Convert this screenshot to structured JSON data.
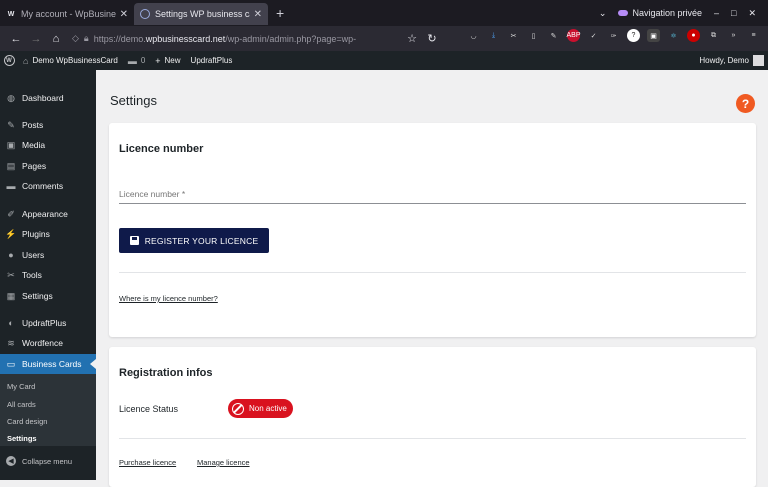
{
  "browser": {
    "tabs": [
      {
        "label": "My account - WpBusinessCard",
        "favicon": "W",
        "active": false
      },
      {
        "label": "Settings WP business card",
        "favicon": "",
        "active": true
      }
    ],
    "new_tab": "+",
    "private_label": "Navigation privée",
    "url_prefix": "https://demo.",
    "url_host": "wpbusinesscard.net",
    "url_path": "/wp-admin/admin.php?page=wp-"
  },
  "adminbar": {
    "site": "Demo WpBusinessCard",
    "comments_count": "0",
    "new_label": "New",
    "plugin_label": "UpdraftPlus",
    "howdy": "Howdy, Demo"
  },
  "sidebar": {
    "items": [
      {
        "label": "Dashboard",
        "icon": "dashboard-icon",
        "glyph": "◍"
      },
      {
        "label": "Posts",
        "icon": "pin-icon",
        "glyph": "✎"
      },
      {
        "label": "Media",
        "icon": "media-icon",
        "glyph": "▣"
      },
      {
        "label": "Pages",
        "icon": "pages-icon",
        "glyph": "▤"
      },
      {
        "label": "Comments",
        "icon": "comments-icon",
        "glyph": "▬"
      },
      {
        "label": "Appearance",
        "icon": "brush-icon",
        "glyph": "✐"
      },
      {
        "label": "Plugins",
        "icon": "plug-icon",
        "glyph": "⚡"
      },
      {
        "label": "Users",
        "icon": "user-icon",
        "glyph": "●"
      },
      {
        "label": "Tools",
        "icon": "wrench-icon",
        "glyph": "✂"
      },
      {
        "label": "Settings",
        "icon": "settings-icon",
        "glyph": "▦"
      },
      {
        "label": "UpdraftPlus",
        "icon": "updraft-icon",
        "glyph": "◐"
      },
      {
        "label": "Wordfence",
        "icon": "wordfence-icon",
        "glyph": "≋"
      },
      {
        "label": "Business Cards",
        "icon": "business-card-icon",
        "glyph": "▭"
      }
    ],
    "submenu": [
      "My Card",
      "All cards",
      "Card design",
      "Settings"
    ],
    "collapse": "Collapse menu"
  },
  "main": {
    "title": "Settings",
    "help": "?",
    "licence": {
      "title": "Licence number",
      "field_label": "Licence number *",
      "button": "REGISTER YOUR LICENCE",
      "help_link": "Where is my licence number?"
    },
    "registration": {
      "title": "Registration infos",
      "status_label": "Licence Status",
      "status_value": "Non active",
      "purchase_link": "Purchase licence",
      "manage_link": "Manage licence"
    }
  },
  "colors": {
    "accent": "#2271b1",
    "button": "#0f1a4a",
    "status_inactive": "#d9121f",
    "help": "#f05a22"
  }
}
